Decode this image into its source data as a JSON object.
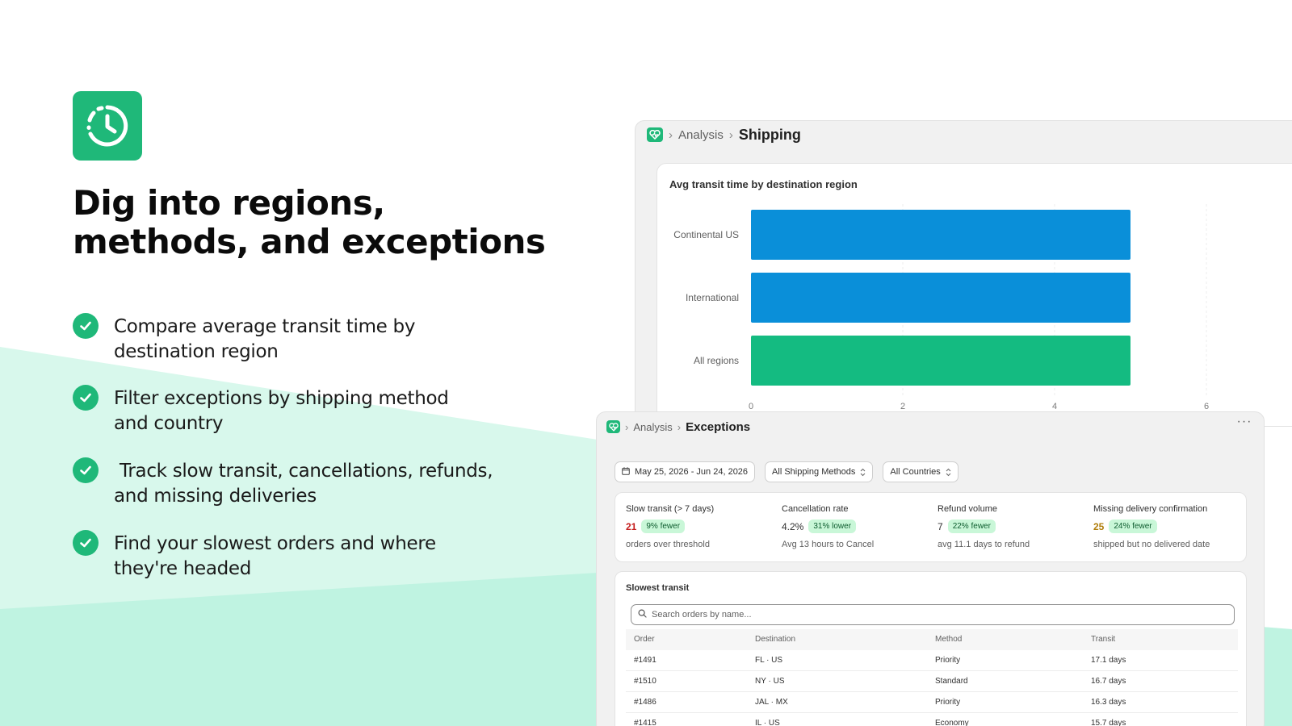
{
  "colors": {
    "brand": "#1fb879",
    "bar_blue": "#0a8fd9",
    "bar_green": "#14bb81",
    "wave": "#bff3e1",
    "value_red": "#c41c1c",
    "value_amber": "#b07d0a"
  },
  "hero": {
    "app_icon": "clock-icon",
    "headline_line1": "Dig into regions,",
    "headline_line2": "methods, and exceptions"
  },
  "features": [
    {
      "line1": "Compare average transit time by",
      "line2": "destination region"
    },
    {
      "line1": "Filter exceptions by shipping method",
      "line2": "and country"
    },
    {
      "line1": " Track slow transit, cancellations, refunds,",
      "line2": "and missing deliveries"
    },
    {
      "line1": "Find your slowest orders and where",
      "line2": "they're headed"
    }
  ],
  "shipping_window": {
    "breadcrumb_parent": "Analysis",
    "breadcrumb_current": "Shipping",
    "chart_title": "Avg transit time by destination region"
  },
  "chart_data": {
    "type": "bar",
    "orientation": "horizontal",
    "title": "Avg transit time by destination region",
    "categories": [
      "Continental US",
      "International",
      "All regions"
    ],
    "values": [
      5,
      5,
      5
    ],
    "xlim": [
      0,
      6
    ],
    "x_ticks": [
      "0",
      "2",
      "4",
      "6"
    ],
    "grid": true
  },
  "exceptions_window": {
    "breadcrumb_parent": "Analysis",
    "breadcrumb_current": "Exceptions",
    "more_label": "···",
    "filters": {
      "date_range": "May 25, 2026 - Jun 24, 2026",
      "method": "All Shipping Methods",
      "country": "All Countries"
    },
    "metrics": [
      {
        "label": "Slow transit (> 7 days)",
        "value": "21",
        "badge": "9% fewer",
        "sub": "orders over threshold"
      },
      {
        "label": "Cancellation rate",
        "value": "4.2%",
        "badge": "31% lower",
        "sub": "Avg 13 hours to Cancel"
      },
      {
        "label": "Refund volume",
        "value": "7",
        "badge": "22% fewer",
        "sub": "avg 11.1 days to refund"
      },
      {
        "label": "Missing delivery confirmation",
        "value": "25",
        "badge": "24% fewer",
        "sub": "shipped but no delivered date"
      }
    ],
    "table": {
      "title": "Slowest transit",
      "search_placeholder": "Search orders by name...",
      "columns": [
        "Order",
        "Destination",
        "Method",
        "Transit"
      ],
      "rows": [
        [
          "#1491",
          "FL · US",
          "Priority",
          "17.1 days"
        ],
        [
          "#1510",
          "NY · US",
          "Standard",
          "16.7 days"
        ],
        [
          "#1486",
          "JAL · MX",
          "Priority",
          "16.3 days"
        ],
        [
          "#1415",
          "IL · US",
          "Economy",
          "15.7 days"
        ]
      ]
    }
  }
}
